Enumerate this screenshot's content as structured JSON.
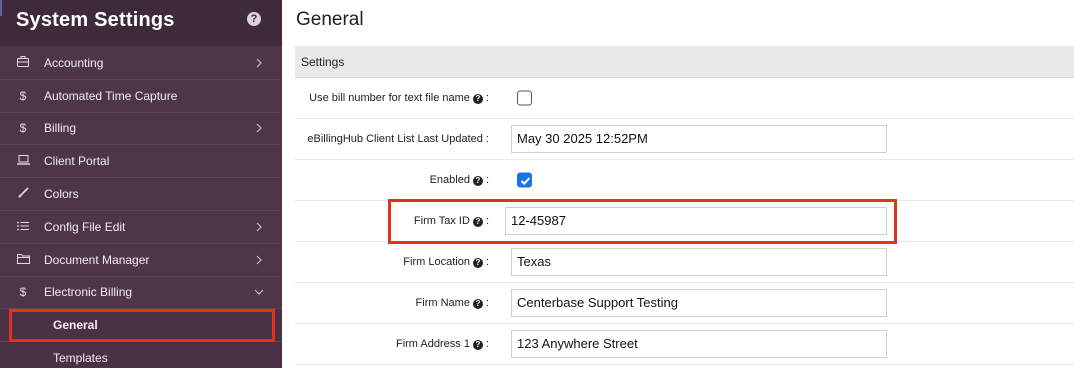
{
  "sidebar": {
    "title": "System Settings",
    "help_icon": "question-circle-icon",
    "items": [
      {
        "label": "Accounting",
        "icon": "briefcase-icon",
        "has_chevron": true
      },
      {
        "label": "Automated Time Capture",
        "icon": "dollar-icon",
        "has_chevron": false
      },
      {
        "label": "Billing",
        "icon": "dollar-icon",
        "has_chevron": true
      },
      {
        "label": "Client Portal",
        "icon": "laptop-icon",
        "has_chevron": false
      },
      {
        "label": "Colors",
        "icon": "paintbrush-icon",
        "has_chevron": false
      },
      {
        "label": "Config File Edit",
        "icon": "list-icon",
        "has_chevron": true
      },
      {
        "label": "Document Manager",
        "icon": "folder-icon",
        "has_chevron": true
      },
      {
        "label": "Electronic Billing",
        "icon": "dollar-icon",
        "has_chevron": true,
        "expanded": true
      }
    ],
    "subitems": [
      {
        "label": "General",
        "active": true
      },
      {
        "label": "Templates",
        "active": false
      }
    ]
  },
  "main": {
    "title": "General",
    "section": "Settings",
    "fields": [
      {
        "label": "Use bill number for text file name",
        "help": true,
        "type": "checkbox",
        "checked": false
      },
      {
        "label": "eBillingHub Client List Last Updated :",
        "help": false,
        "type": "text",
        "value": "May 30 2025 12:52PM"
      },
      {
        "label": "Enabled",
        "help": true,
        "type": "checkbox",
        "checked": true
      },
      {
        "label": "Firm Tax ID",
        "help": true,
        "type": "text",
        "value": "12-45987"
      },
      {
        "label": "Firm Location",
        "help": true,
        "type": "text",
        "value": "Texas"
      },
      {
        "label": "Firm Name",
        "help": true,
        "type": "text",
        "value": "Centerbase Support Testing"
      },
      {
        "label": "Firm Address 1",
        "help": true,
        "type": "text",
        "value": "123 Anywhere Street"
      }
    ]
  },
  "colors": {
    "sidebar_bg": "#4e3548",
    "sidebar_header_bg": "#3f2a3b",
    "highlight": "#e0321c",
    "checkbox_checked": "#1a73e8"
  }
}
